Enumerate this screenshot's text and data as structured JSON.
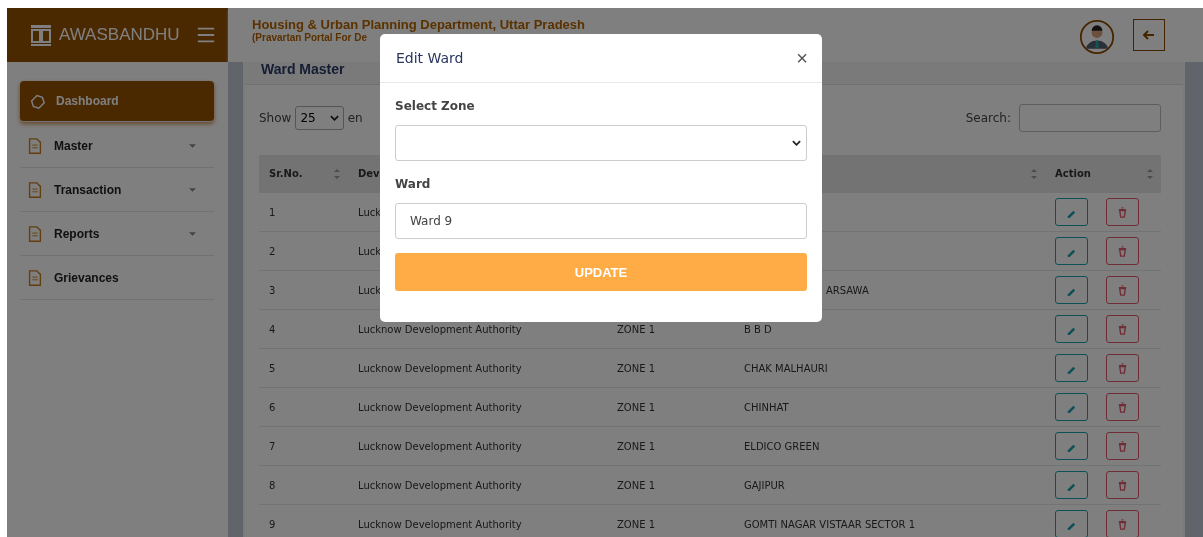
{
  "brand": {
    "name": "AWASBANDHU"
  },
  "header": {
    "title": "Housing & Urban Planning Department, Uttar Pradesh",
    "subtitle": "(Pravartan Portal For De"
  },
  "sidebar": {
    "items": [
      {
        "label": "Dashboard",
        "selected": true,
        "expandable": false
      },
      {
        "label": "Master",
        "selected": false,
        "expandable": true
      },
      {
        "label": "Transaction",
        "selected": false,
        "expandable": true
      },
      {
        "label": "Reports",
        "selected": false,
        "expandable": true
      },
      {
        "label": "Grievances",
        "selected": false,
        "expandable": false
      }
    ]
  },
  "page": {
    "title": "Ward Master",
    "show_label": "Show",
    "page_size": "25",
    "entries_label": "en",
    "search_label": "Search:"
  },
  "table": {
    "columns": [
      "Sr.No.",
      "Dev",
      "",
      "",
      "Action"
    ],
    "rows": [
      {
        "sr": "1",
        "authority": "Luck"
      },
      {
        "sr": "2",
        "authority": "Luck"
      },
      {
        "sr": "3",
        "authority": "Luck",
        "ward": "ARSAWA"
      },
      {
        "sr": "4",
        "authority": "Lucknow Development Authority",
        "zone": "ZONE 1",
        "ward": "B B D"
      },
      {
        "sr": "5",
        "authority": "Lucknow Development Authority",
        "zone": "ZONE 1",
        "ward": "CHAK MALHAURI"
      },
      {
        "sr": "6",
        "authority": "Lucknow Development Authority",
        "zone": "ZONE 1",
        "ward": "CHINHAT"
      },
      {
        "sr": "7",
        "authority": "Lucknow Development Authority",
        "zone": "ZONE 1",
        "ward": "ELDICO GREEN"
      },
      {
        "sr": "8",
        "authority": "Lucknow Development Authority",
        "zone": "ZONE 1",
        "ward": "GAJIPUR"
      },
      {
        "sr": "9",
        "authority": "Lucknow Development Authority",
        "zone": "ZONE 1",
        "ward": "GOMTI NAGAR VISTAAR SECTOR 1"
      }
    ]
  },
  "modal": {
    "title": "Edit Ward",
    "close": "×",
    "zone_label": "Select Zone",
    "ward_label": "Ward",
    "ward_value": "Ward 9",
    "button": "UPDATE"
  }
}
